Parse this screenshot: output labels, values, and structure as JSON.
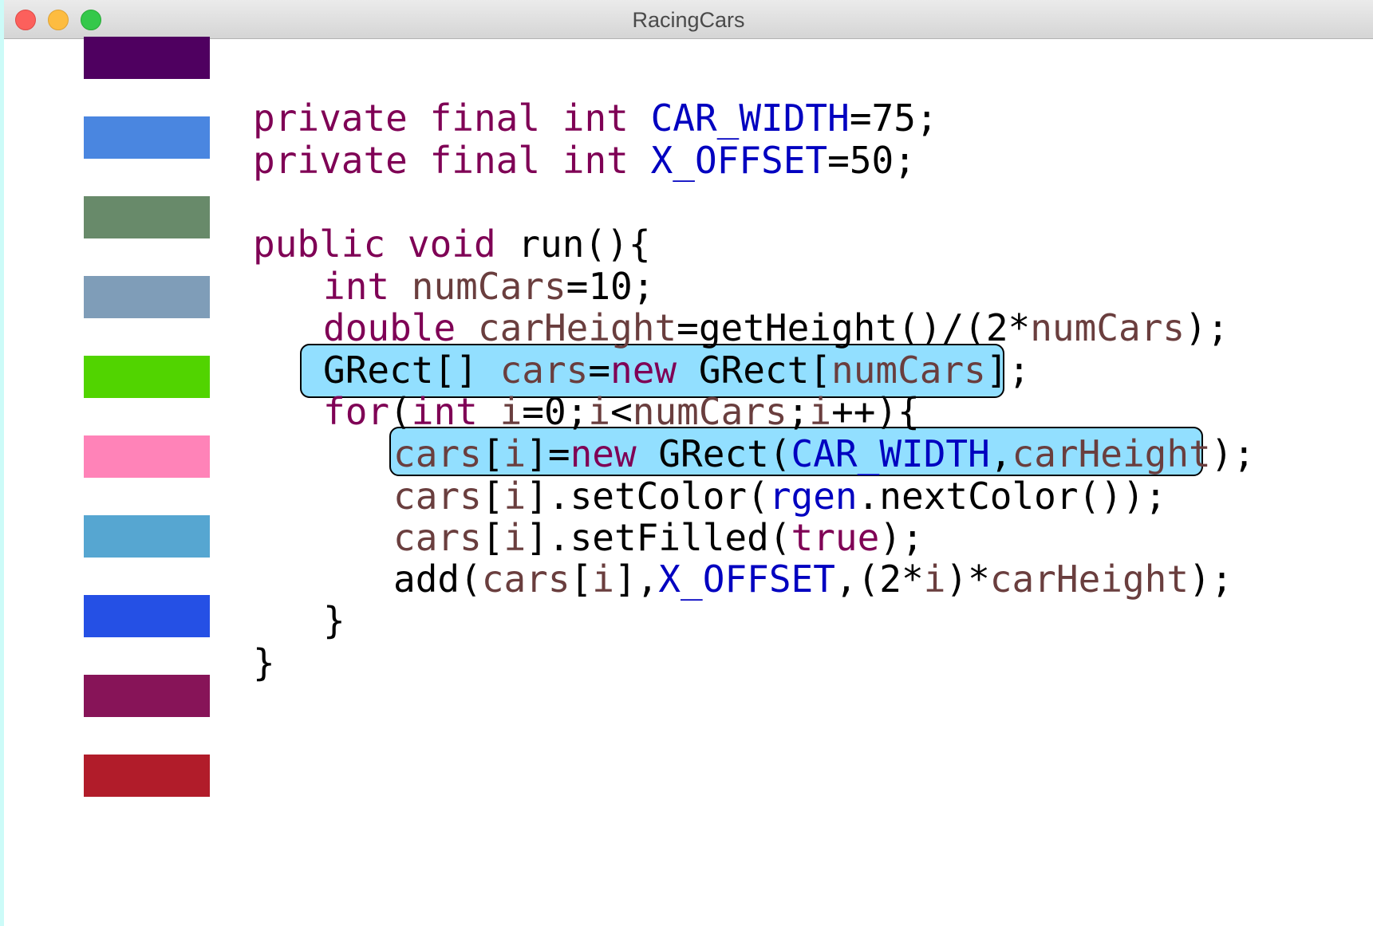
{
  "window": {
    "title": "RacingCars"
  },
  "colors": {
    "keyword": "#7f0055",
    "constant": "#0000c0",
    "local_variable": "#6a3e3e",
    "plain": "#000000",
    "highlight_fill": "#64d2ff",
    "highlight_border": "#000000"
  },
  "cars": [
    {
      "color": "#4f0060"
    },
    {
      "color": "#4a86e0"
    },
    {
      "color": "#688a6a"
    },
    {
      "color": "#7f9db8"
    },
    {
      "color": "#51d400"
    },
    {
      "color": "#ff83b8"
    },
    {
      "color": "#56a6d1"
    },
    {
      "color": "#2550e5"
    },
    {
      "color": "#871458"
    },
    {
      "color": "#b11c2a"
    }
  ],
  "code": {
    "line1": {
      "t1": "private",
      "t2": " ",
      "t3": "final",
      "t4": " ",
      "t5": "int",
      "t6": " ",
      "t7": "CAR_WIDTH",
      "t8": "=75;"
    },
    "line2": {
      "t1": "private",
      "t2": " ",
      "t3": "final",
      "t4": " ",
      "t5": "int",
      "t6": " ",
      "t7": "X_OFFSET",
      "t8": "=50;"
    },
    "line3": {
      "t1": "public",
      "t2": " ",
      "t3": "void",
      "t4": " run(){"
    },
    "line4": {
      "t1": "int",
      "t2": " ",
      "t3": "numCars",
      "t4": "=10;"
    },
    "line5": {
      "t1": "double",
      "t2": " ",
      "t3": "carHeight",
      "t4": "=getHeight()/(2*",
      "t5": "numCars",
      "t6": ");"
    },
    "line6": {
      "t1": "GRect[] ",
      "t2": "cars",
      "t3": "=",
      "t4": "new",
      "t5": " GRect[",
      "t6": "numCars",
      "t7": "];"
    },
    "line7": {
      "t1": "for",
      "t2": "(",
      "t3": "int",
      "t4": " ",
      "t5": "i",
      "t6": "=0;",
      "t7": "i",
      "t8": "<",
      "t9": "numCars",
      "t10": ";",
      "t11": "i",
      "t12": "++){"
    },
    "line8": {
      "t1": "cars",
      "t2": "[",
      "t3": "i",
      "t4": "]=",
      "t5": "new",
      "t6": " GRect(",
      "t7": "CAR_WIDTH",
      "t8": ",",
      "t9": "carHeight",
      "t10": ");"
    },
    "line9": {
      "t1": "cars",
      "t2": "[",
      "t3": "i",
      "t4": "].setColor(",
      "t5": "rgen",
      "t6": ".nextColor());"
    },
    "line10": {
      "t1": "cars",
      "t2": "[",
      "t3": "i",
      "t4": "].setFilled(",
      "t5": "true",
      "t6": ");"
    },
    "line11": {
      "t1": "add(",
      "t2": "cars",
      "t3": "[",
      "t4": "i",
      "t5": "],",
      "t6": "X_OFFSET",
      "t7": ",(2*",
      "t8": "i",
      "t9": ")*",
      "t10": "carHeight",
      "t11": ");"
    },
    "line12": {
      "t1": "}"
    },
    "line13": {
      "t1": "}"
    }
  }
}
